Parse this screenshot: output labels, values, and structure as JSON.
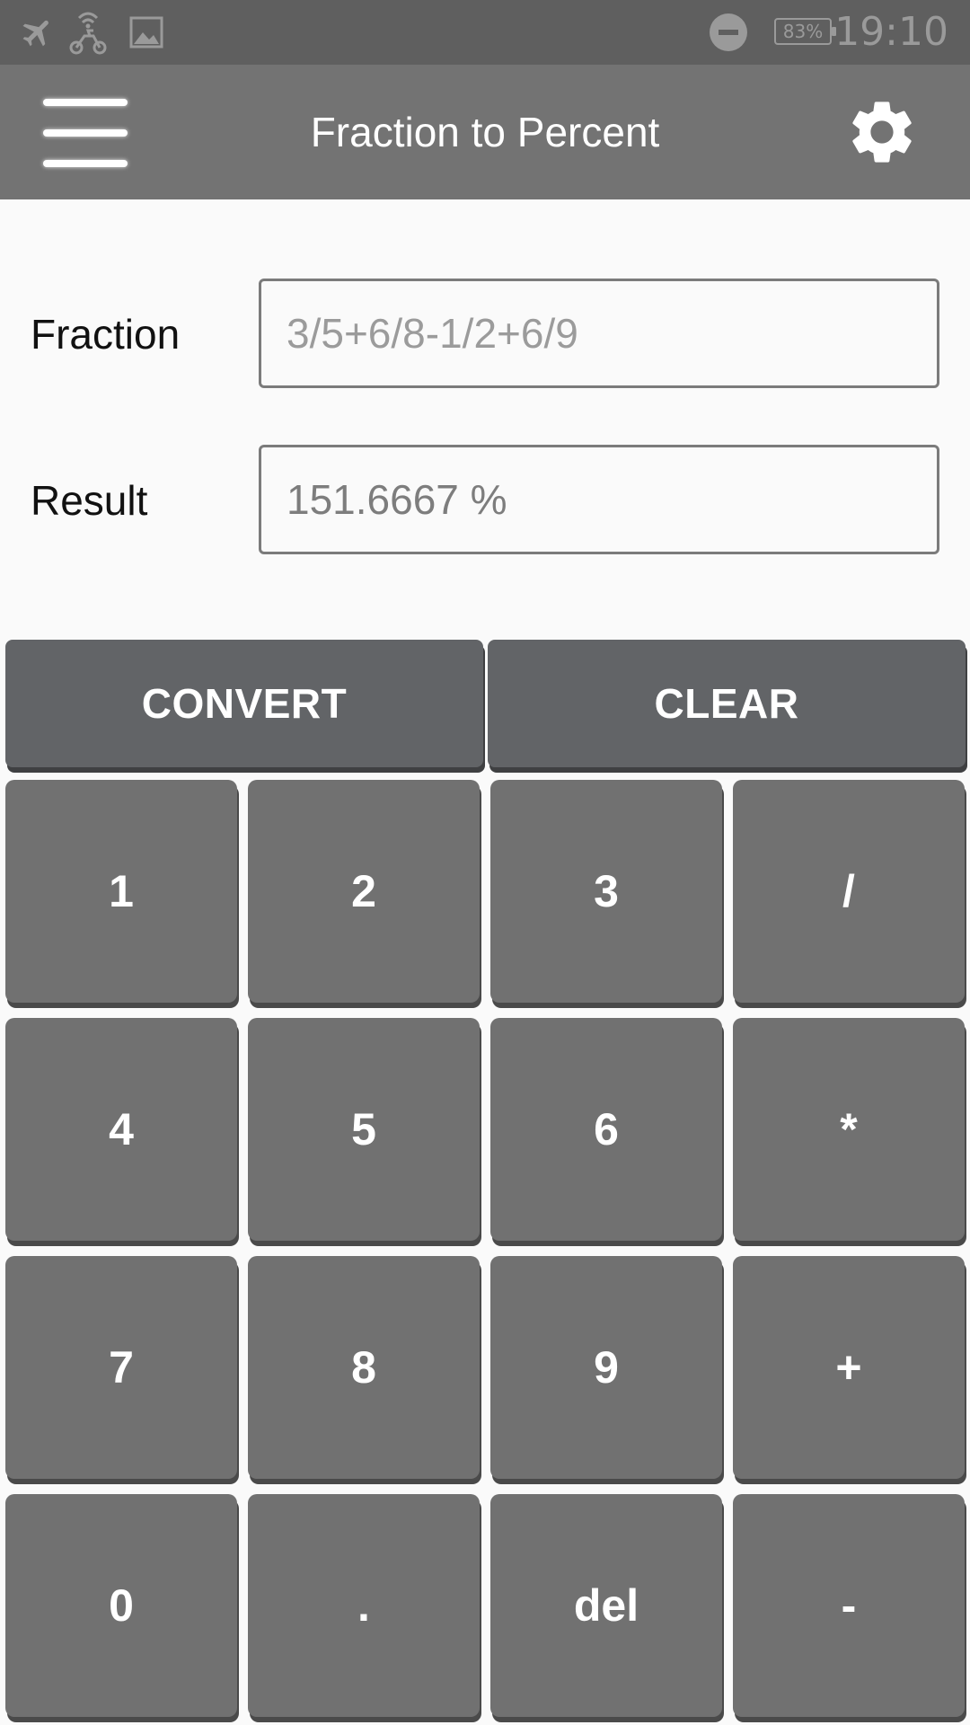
{
  "status_bar": {
    "time": "19:10",
    "battery": "83%",
    "icons": [
      "airplane-mode-icon",
      "scooter-wifi-icon",
      "image-icon",
      "do-not-disturb-icon",
      "battery-icon"
    ]
  },
  "app_bar": {
    "title": "Fraction to Percent",
    "icons": [
      "menu-icon",
      "gear-icon"
    ]
  },
  "form": {
    "fraction_label": "Fraction",
    "fraction_placeholder": "3/5+6/8-1/2+6/9",
    "fraction_value": "",
    "result_label": "Result",
    "result_value": "151.6667 %"
  },
  "actions": {
    "convert": "CONVERT",
    "clear": "CLEAR"
  },
  "keypad": {
    "keys": [
      "1",
      "2",
      "3",
      "/",
      "4",
      "5",
      "6",
      "*",
      "7",
      "8",
      "9",
      "+",
      "0",
      ".",
      "del",
      "-"
    ]
  },
  "colors": {
    "status_bar": "#5f5f5f",
    "app_bar": "#737373",
    "action_button": "#626467",
    "key": "#717171",
    "background": "#fafafa"
  }
}
